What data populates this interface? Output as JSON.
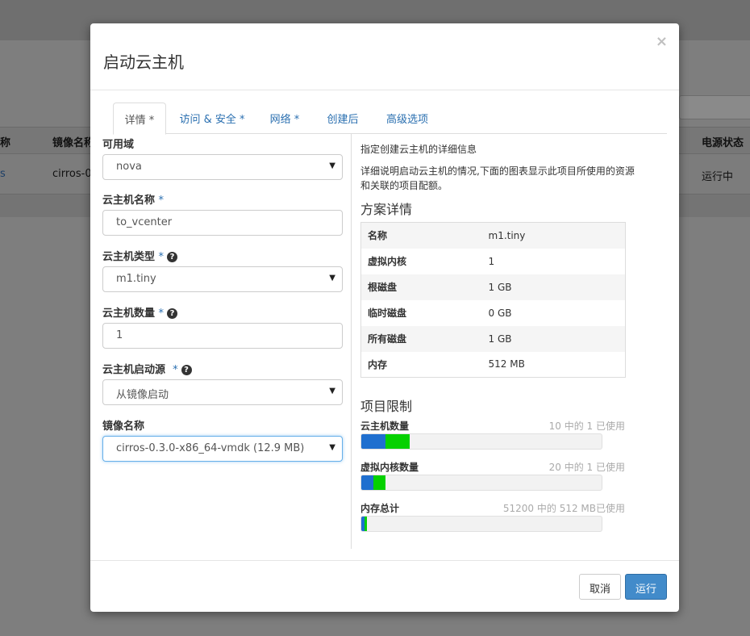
{
  "background": {
    "table_headers": [
      "称",
      "镜像名称",
      "电源状态"
    ],
    "row": [
      "s",
      "cirros-0.",
      "运行中"
    ]
  },
  "modal": {
    "title": "启动云主机",
    "close_glyph": "×",
    "tabs": [
      {
        "label": "详情 *",
        "active": true
      },
      {
        "label": "访问 & 安全 *",
        "active": false
      },
      {
        "label": "网络 *",
        "active": false
      },
      {
        "label": "创建后",
        "active": false
      },
      {
        "label": "高级选项",
        "active": false
      }
    ],
    "form": {
      "availability_zone": {
        "label": "可用域",
        "value": "nova"
      },
      "instance_name": {
        "label": "云主机名称",
        "required": "*",
        "value": "to_vcenter"
      },
      "flavor": {
        "label": "云主机类型",
        "required": "*",
        "value": "m1.tiny"
      },
      "count": {
        "label": "云主机数量",
        "required": "*",
        "value": "1"
      },
      "boot_source": {
        "label": "云主机启动源",
        "required": "*",
        "value": "从镜像启动"
      },
      "image_name": {
        "label": "镜像名称",
        "value": "cirros-0.3.0-x86_64-vmdk (12.9 MB)"
      }
    },
    "details": {
      "heading": "指定创建云主机的详细信息",
      "description": "详细说明启动云主机的情况,下面的图表显示此项目所使用的资源和关联的项目配额。",
      "flavor_title": "方案详情",
      "flavor_rows": [
        {
          "key": "名称",
          "value": "m1.tiny"
        },
        {
          "key": "虚拟内核",
          "value": "1"
        },
        {
          "key": "根磁盘",
          "value": "1 GB"
        },
        {
          "key": "临时磁盘",
          "value": "0 GB"
        },
        {
          "key": "所有磁盘",
          "value": "1 GB"
        },
        {
          "key": "内存",
          "value": "512 MB"
        }
      ],
      "limits_title": "项目限制",
      "quotas": [
        {
          "label": "云主机数量",
          "usage": "10 中的 1 已使用",
          "used_fraction": 0.1,
          "added_fraction": 0.1
        },
        {
          "label": "虚拟内核数量",
          "usage": "20 中的 1 已使用",
          "used_fraction": 0.05,
          "added_fraction": 0.05
        },
        {
          "label": "内存总计",
          "usage": "51200 中的 512 MB已使用",
          "used_fraction": 0.01,
          "added_fraction": 0.01
        }
      ]
    },
    "footer": {
      "cancel": "取消",
      "run": "运行"
    }
  },
  "colors": {
    "accent": "#428bca",
    "link": "#2a6fb0",
    "quota_used": "#1f6fcf",
    "quota_added": "#05d100"
  }
}
